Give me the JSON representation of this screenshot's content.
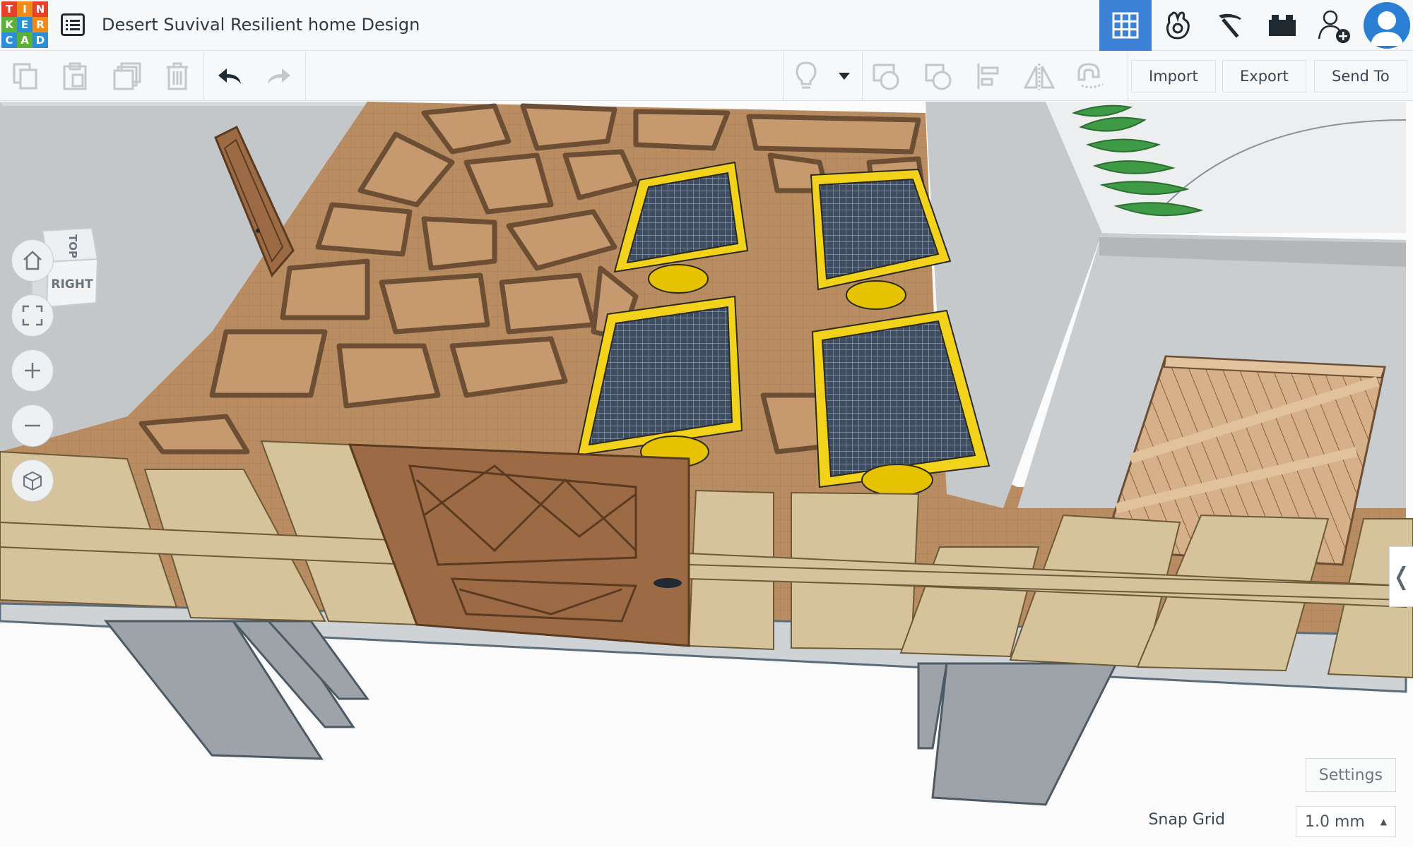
{
  "app": {
    "logo_letters": [
      "T",
      "I",
      "N",
      "K",
      "E",
      "R",
      "C",
      "A",
      "D"
    ],
    "logo_colors": [
      "#e8412b",
      "#f08a1a",
      "#e8412b",
      "#5db037",
      "#2a8fd6",
      "#f08a1a",
      "#2a8fd6",
      "#5db037",
      "#2a8fd6"
    ]
  },
  "header": {
    "design_title": "Desert Suvival Resilient home Design",
    "icons": [
      "grid-view-icon",
      "brick-mode-icon",
      "minecraft-pickaxe-icon",
      "lego-brick-icon",
      "invite-user-icon",
      "user-avatar"
    ]
  },
  "toolbar": {
    "import_label": "Import",
    "export_label": "Export",
    "send_to_label": "Send To"
  },
  "view_cube": {
    "top_label": "TOP",
    "front_label": "RIGHT"
  },
  "workplane": {
    "settings_label": "Settings",
    "snap_grid_label": "Snap Grid",
    "snap_grid_value": "1.0 mm",
    "collapse_glyph": "❬"
  },
  "colors": {
    "accent": "#3b82d6",
    "floor": "#b98c62",
    "floor_lines": "#6b4e33",
    "wood_light": "#d6c39b",
    "door": "#9c6b45",
    "solar_frame": "#f2d21b",
    "solar_cells": "#3f4d63",
    "wall": "#c5c9cc"
  }
}
